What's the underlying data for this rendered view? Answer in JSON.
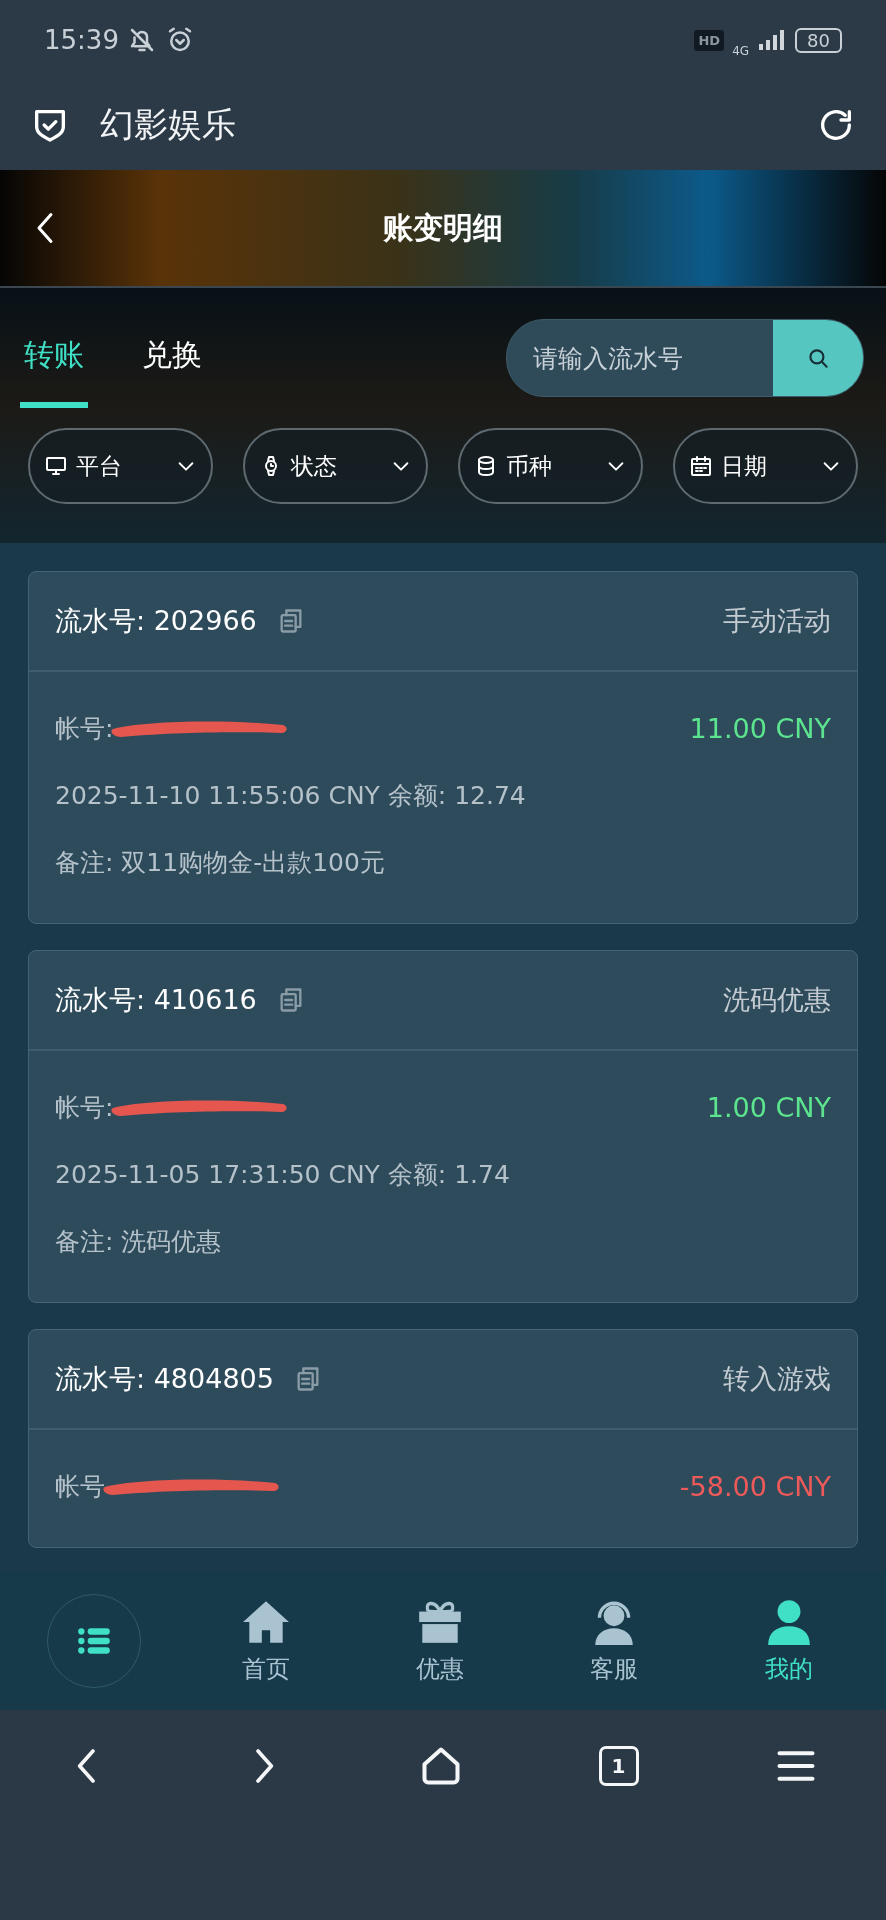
{
  "status_bar": {
    "time": "15:39",
    "hd": "HD",
    "network": "4G",
    "battery": "80"
  },
  "app_bar": {
    "title": "幻影娱乐"
  },
  "page_header": {
    "title": "账变明细"
  },
  "tabs": [
    {
      "label": "转账",
      "selected": true
    },
    {
      "label": "兑换",
      "selected": false
    }
  ],
  "search": {
    "placeholder": "请输入流水号"
  },
  "filters": [
    {
      "kind": "platform",
      "label": "平台"
    },
    {
      "kind": "status",
      "label": "状态"
    },
    {
      "kind": "currency",
      "label": "币种"
    },
    {
      "kind": "date",
      "label": "日期"
    }
  ],
  "records": [
    {
      "serial": "流水号: 202966",
      "type": "手动活动",
      "account_label": "帐号:",
      "amount": "11.00 CNY",
      "color": "#5ce58e",
      "details": "2025-11-10 11:55:06 CNY 余额: 12.74",
      "note": "备注: 双11购物金-出款100元"
    },
    {
      "serial": "流水号: 410616",
      "type": "洗码优惠",
      "account_label": "帐号:",
      "amount": "1.00 CNY",
      "color": "#5ce58e",
      "details": "2025-11-05 17:31:50 CNY 余额: 1.74",
      "note": "备注: 洗码优惠"
    },
    {
      "serial": "流水号: 4804805",
      "type": "转入游戏",
      "account_label": "帐号",
      "amount": "-58.00 CNY",
      "color": "#ee5a5a"
    }
  ],
  "bottom_nav": [
    {
      "kind": "menu"
    },
    {
      "kind": "home",
      "label": "首页",
      "selected": false
    },
    {
      "kind": "gift",
      "label": "优惠",
      "selected": false
    },
    {
      "kind": "support",
      "label": "客服",
      "selected": false
    },
    {
      "kind": "profile",
      "label": "我的",
      "selected": true
    }
  ],
  "browser_bar": {
    "tab_count": "1"
  }
}
